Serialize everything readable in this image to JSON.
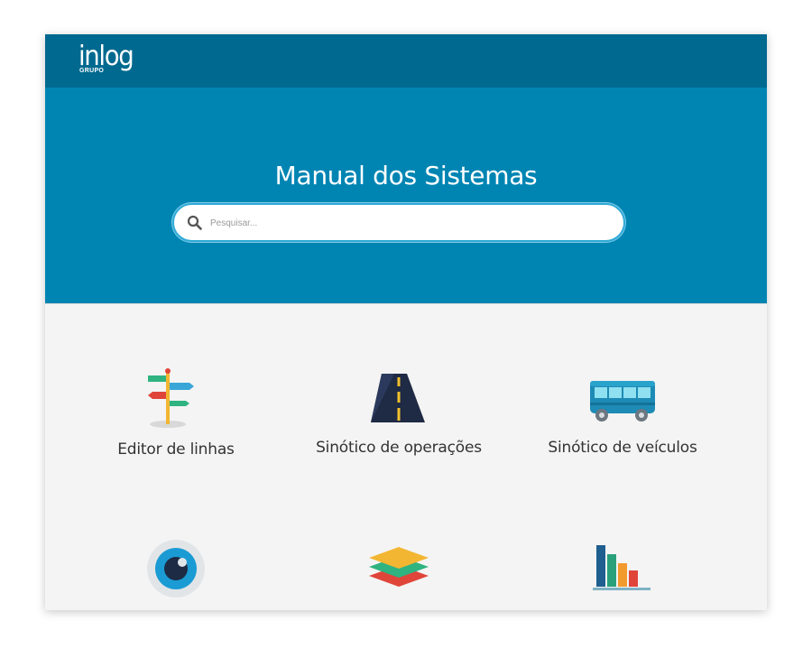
{
  "header": {
    "logo_text": "inlog",
    "logo_subtext": "GRUPO"
  },
  "hero": {
    "title": "Manual dos Sistemas"
  },
  "search": {
    "placeholder": "Pesquisar..."
  },
  "systems": [
    {
      "label": "Editor de linhas",
      "icon": "signpost-icon"
    },
    {
      "label": "Sinótico de operações",
      "icon": "road-icon"
    },
    {
      "label": "Sinótico de veículos",
      "icon": "bus-icon"
    },
    {
      "label": "",
      "icon": "eye-icon"
    },
    {
      "label": "",
      "icon": "layers-icon"
    },
    {
      "label": "",
      "icon": "bar-chart-icon"
    }
  ],
  "colors": {
    "header_bg": "#00698f",
    "hero_bg": "#0085b3",
    "content_bg": "#f4f4f4"
  }
}
